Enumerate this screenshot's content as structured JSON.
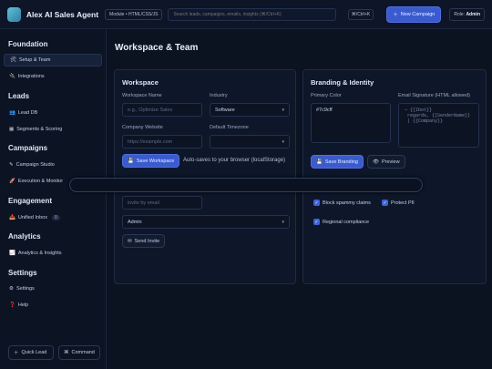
{
  "topbar": {
    "app_title": "Alex AI Sales Agent",
    "module_pill": "Module • HTML/CSS/JS",
    "search_placeholder": "Search leads, campaigns, emails, insights (⌘/Ctrl+K)",
    "shortcut": "⌘/Ctrl+K",
    "new_campaign": "New Campaign",
    "role_label": "Role:",
    "role_value": "Admin"
  },
  "sidebar": {
    "sections": [
      "Foundation",
      "Leads",
      "Campaigns",
      "Engagement",
      "Analytics",
      "Settings"
    ],
    "items": {
      "setup_team": "Setup & Team",
      "integrations": "Integrations",
      "lead_db": "Lead DB",
      "segments": "Segments & Scoring",
      "campaign_studio": "Campaign Studio",
      "execution": "Execution & Monitor",
      "unified_inbox": "Unified Inbox",
      "inbox_count": "0",
      "analytics": "Analytics & Insights",
      "settings": "Settings",
      "help": "Help"
    },
    "quick_lead": "Quick Lead",
    "command": "Command"
  },
  "main": {
    "page_title": "Workspace & Team",
    "workspace": {
      "title": "Workspace",
      "name_label": "Workspace Name",
      "name_placeholder": "e.g., Optimize Sales",
      "industry_label": "Industry",
      "industry_value": "Software",
      "website_label": "Company Website",
      "website_placeholder": "https://example.com",
      "timezone_label": "Default Timezone",
      "save": "Save Workspace",
      "note": "Auto-saves to your browser (localStorage)",
      "invite_placeholder": "invite by email",
      "role_value": "Admin",
      "send_invite": "Send Invite"
    },
    "branding": {
      "title": "Branding & Identity",
      "primary_color_label": "Primary Color",
      "primary_color_value": "#7c9cff",
      "signature_label": "Email Signature (HTML allowed)",
      "signature_placeholder": "— {{Ibot}}\n regards, {{SenderName}}\n | {{Company}}",
      "save": "Save Branding",
      "preview": "Preview",
      "check_1": "Block spammy claims",
      "check_2": "Protect PII",
      "check_3": "Regional compliance"
    }
  },
  "colors": {
    "accent": "#3a5bd0",
    "background": "#0b1220"
  }
}
